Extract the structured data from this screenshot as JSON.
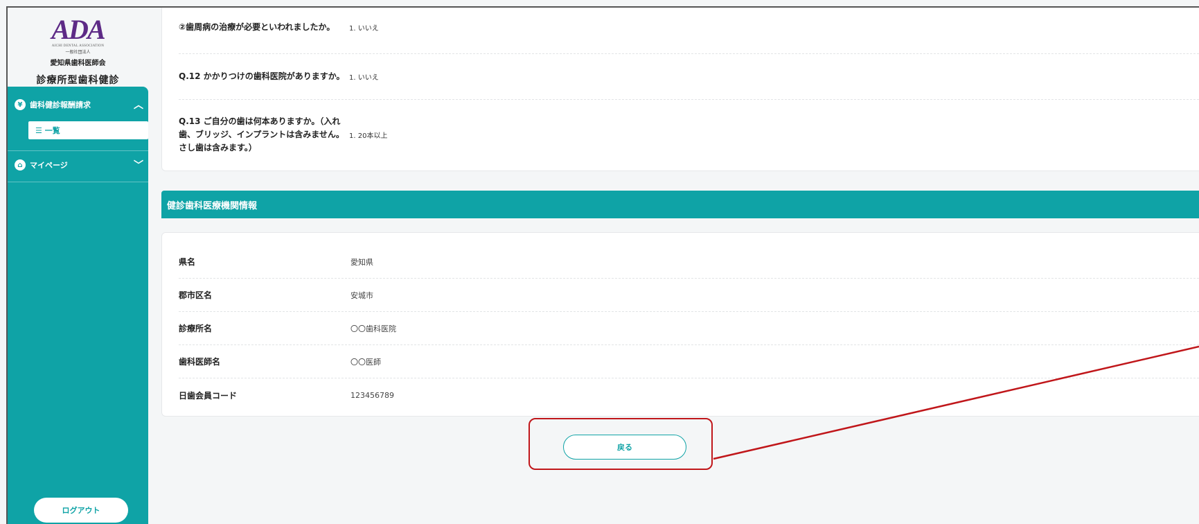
{
  "sidebar": {
    "logo_mark": "ADA",
    "logo_en": "AICHI DENTAL ASSOCIATION",
    "logo_corp": "一般社団法人",
    "logo_org": "愛知県歯科医師会",
    "app_title": "診療所型歯科健診",
    "sections": [
      {
        "label": "歯科健診報酬請求",
        "icon": "yen-coin-icon",
        "chevron": "^"
      },
      {
        "label": "マイページ",
        "icon": "home-icon",
        "chevron": "v"
      }
    ],
    "sub_item": "☰ 一覧",
    "logout_label": "ログアウト"
  },
  "questions": [
    {
      "q": "②歯周病の治療が必要といわれましたか。",
      "a": "1. いいえ"
    },
    {
      "q": "Q.12 かかりつけの歯科医院がありますか。",
      "a": "1. いいえ"
    },
    {
      "q": "Q.13 ご自分の歯は何本ありますか。（入れ歯、ブリッジ、インプラントは含みません。さし歯は含みます。）",
      "a": "1. 20本以上"
    }
  ],
  "section_title": "健診歯科医療機関情報",
  "info": [
    {
      "label": "県名",
      "value": "愛知県"
    },
    {
      "label": "郡市区名",
      "value": "安城市"
    },
    {
      "label": "診療所名",
      "value": "〇〇歯科医院"
    },
    {
      "label": "歯科医師名",
      "value": "〇〇医師"
    },
    {
      "label": "日歯会員コード",
      "value": "123456789"
    }
  ],
  "back_label": "戻る",
  "colors": {
    "teal": "#0fa3a6",
    "logo_purple": "#5d2a86",
    "annotation_red": "#c0161a"
  }
}
